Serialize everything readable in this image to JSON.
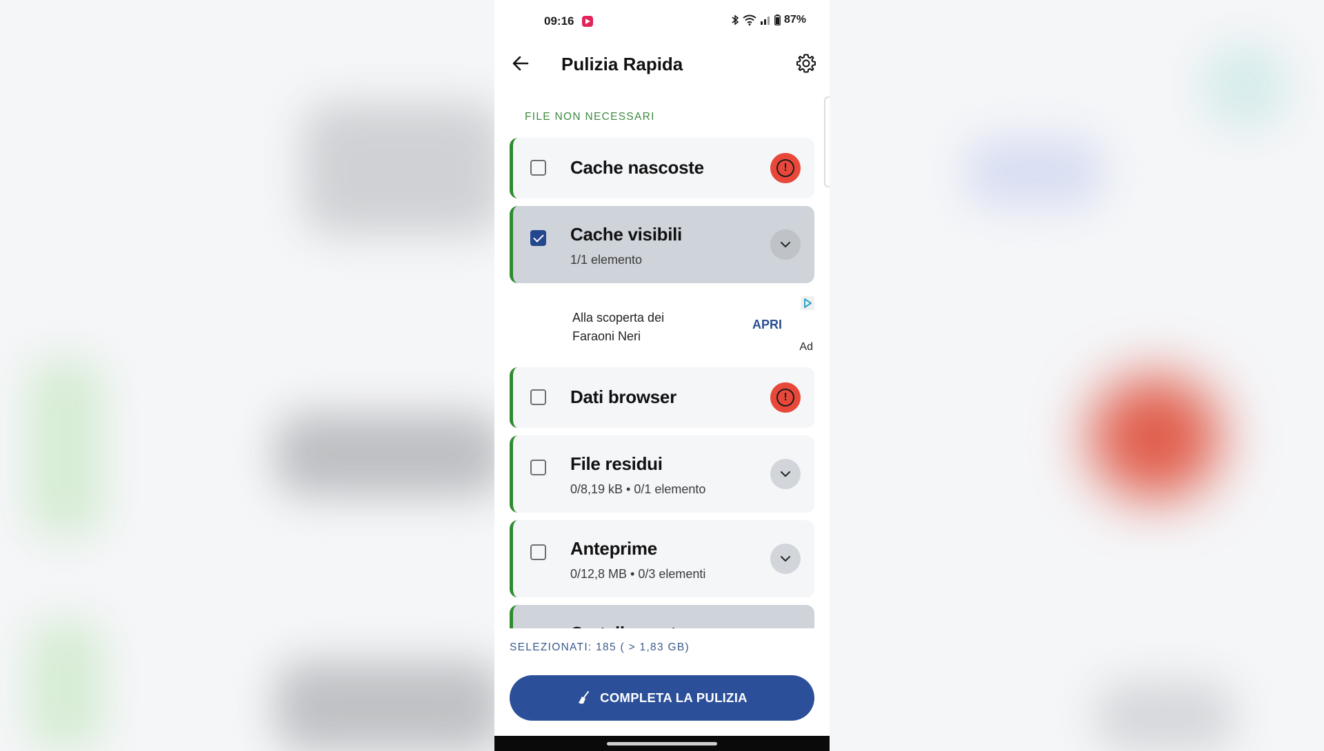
{
  "status_bar": {
    "time": "09:16",
    "battery": "87%",
    "icons": [
      "screen-record-icon",
      "bluetooth-icon",
      "wifi-icon",
      "signal-icon",
      "battery-icon"
    ]
  },
  "app_bar": {
    "title": "Pulizia Rapida",
    "back_icon": "arrow-left-icon",
    "settings_icon": "gear-icon"
  },
  "section": {
    "label": "FILE NON NECESSARI"
  },
  "items": [
    {
      "title": "Cache nascoste",
      "subtitle": "",
      "checked": false,
      "action": "alert-icon"
    },
    {
      "title": "Cache visibili",
      "subtitle": "1/1 elemento",
      "checked": true,
      "action": "chevron-down-icon"
    },
    {
      "title": "Dati browser",
      "subtitle": "",
      "checked": false,
      "action": "alert-icon"
    },
    {
      "title": "File residui",
      "subtitle": "0/8,19 kB • 0/1 elemento",
      "checked": false,
      "action": "chevron-down-icon"
    },
    {
      "title": "Anteprime",
      "subtitle": "0/12,8 MB • 0/3 elementi",
      "checked": false,
      "action": "chevron-down-icon"
    },
    {
      "title": "Cartelle vuote",
      "subtitle": "",
      "checked": true,
      "action": "chevron-down-icon"
    }
  ],
  "ad": {
    "text_line1": "Alla scoperta dei",
    "text_line2": "Faraoni Neri",
    "cta": "APRI",
    "label": "Ad"
  },
  "footer": {
    "selection_summary": "SELEZIONATI: 185 ( > 1,83 GB)",
    "clean_button_label": "COMPLETA LA PULIZIA",
    "clean_button_icon": "broom-icon"
  },
  "colors": {
    "accent": "#2b4f99",
    "section_green": "#3d8a3f",
    "alert_red": "#e8483a",
    "card_border_green": "#2e8b2e"
  }
}
